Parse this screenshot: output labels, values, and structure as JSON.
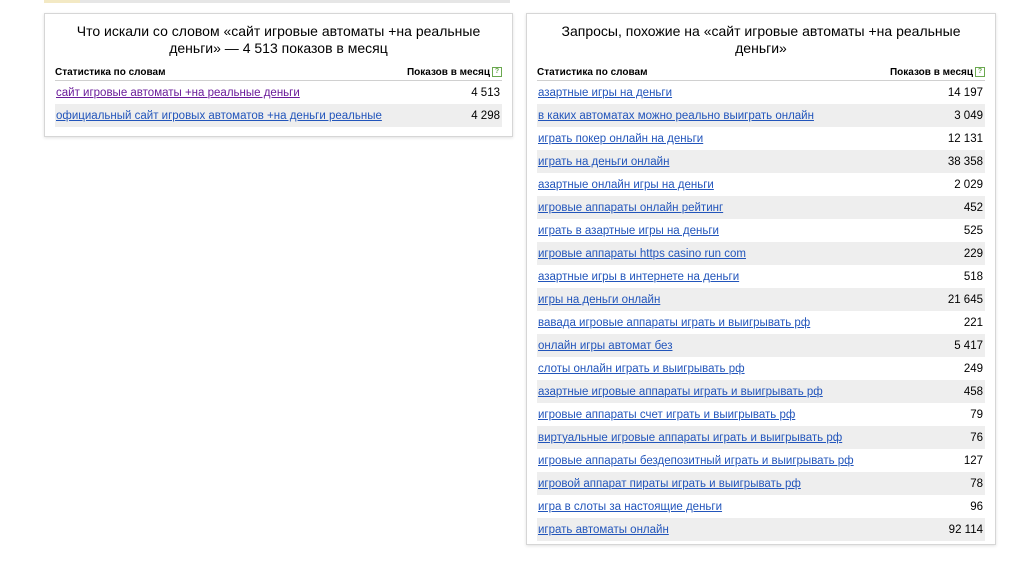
{
  "left_panel": {
    "title": "Что искали со словом «сайт игровые автоматы +на реальные деньги» — 4 513 показов в месяц",
    "col_phrase": "Статистика по словам",
    "col_count": "Показов в месяц",
    "help_symbol": "?",
    "rows": [
      {
        "phrase": "сайт игровые автоматы +на реальные деньги",
        "count": "4 513",
        "visited": true
      },
      {
        "phrase": "официальный сайт игровых автоматов +на деньги реальные",
        "count": "4 298",
        "visited": false
      }
    ]
  },
  "right_panel": {
    "title": "Запросы, похожие на «сайт игровые автоматы +на реальные деньги»",
    "col_phrase": "Статистика по словам",
    "col_count": "Показов в месяц",
    "help_symbol": "?",
    "rows": [
      {
        "phrase": "азартные игры на деньги",
        "count": "14 197"
      },
      {
        "phrase": "в каких автоматах можно реально выиграть онлайн",
        "count": "3 049"
      },
      {
        "phrase": "играть покер онлайн на деньги",
        "count": "12 131"
      },
      {
        "phrase": "играть на деньги онлайн",
        "count": "38 358"
      },
      {
        "phrase": "азартные онлайн игры на деньги",
        "count": "2 029"
      },
      {
        "phrase": "игровые аппараты онлайн рейтинг",
        "count": "452"
      },
      {
        "phrase": "играть в азартные игры на деньги",
        "count": "525"
      },
      {
        "phrase": "игровые аппараты https casino run com",
        "count": "229"
      },
      {
        "phrase": "азартные игры в интернете на деньги",
        "count": "518"
      },
      {
        "phrase": "игры на деньги онлайн",
        "count": "21 645"
      },
      {
        "phrase": "вавада игровые аппараты играть и выигрывать рф",
        "count": "221"
      },
      {
        "phrase": "онлайн игры автомат без",
        "count": "5 417"
      },
      {
        "phrase": "слоты онлайн играть и выигрывать рф",
        "count": "249"
      },
      {
        "phrase": "азартные игровые аппараты играть и выигрывать рф",
        "count": "458"
      },
      {
        "phrase": "игровые аппараты счет играть и выигрывать рф",
        "count": "79"
      },
      {
        "phrase": "виртуальные игровые аппараты играть и выигрывать рф",
        "count": "76"
      },
      {
        "phrase": "игровые аппараты бездепозитный играть и выигрывать рф",
        "count": "127"
      },
      {
        "phrase": "игровой аппарат пираты играть и выигрывать рф",
        "count": "78"
      },
      {
        "phrase": "игра в слоты за настоящие деньги",
        "count": "96"
      },
      {
        "phrase": "играть автоматы онлайн",
        "count": "92 114"
      }
    ]
  },
  "colors": {
    "link": "#2255bb",
    "visited_link": "#6a1b9a",
    "row_stripe": "#eeeeee",
    "help_icon": "#6aa84f"
  }
}
